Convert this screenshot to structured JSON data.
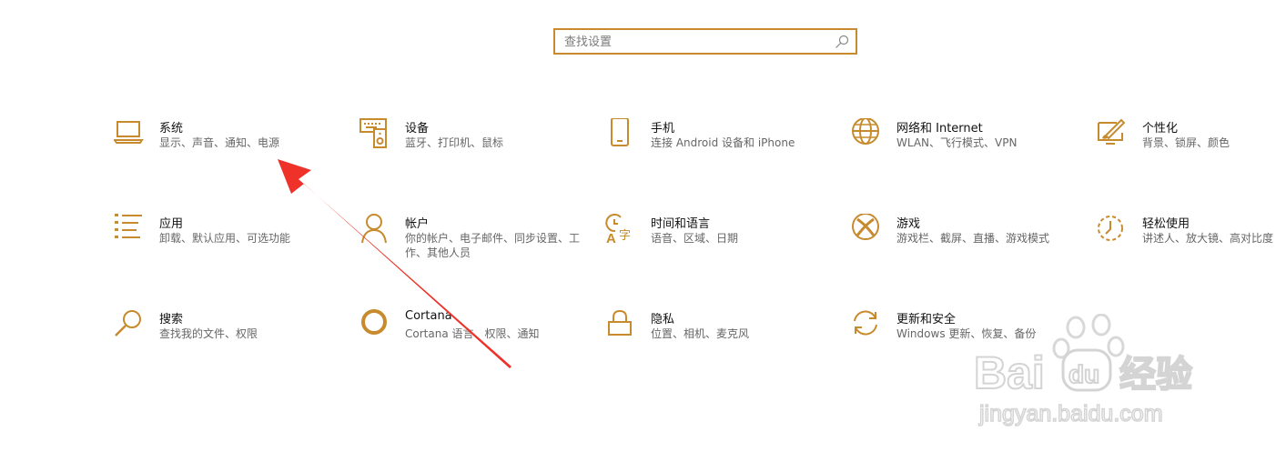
{
  "search": {
    "placeholder": "查找设置"
  },
  "accent": "#c78b2e",
  "tiles": [
    {
      "title": "系统",
      "desc": "显示、声音、通知、电源",
      "icon": "laptop-icon"
    },
    {
      "title": "设备",
      "desc": "蓝牙、打印机、鼠标",
      "icon": "keyboard-speaker-icon"
    },
    {
      "title": "手机",
      "desc": "连接 Android 设备和 iPhone",
      "icon": "phone-icon"
    },
    {
      "title": "网络和 Internet",
      "desc": "WLAN、飞行模式、VPN",
      "icon": "globe-icon"
    },
    {
      "title": "个性化",
      "desc": "背景、锁屏、颜色",
      "icon": "paint-icon"
    },
    {
      "title": "应用",
      "desc": "卸载、默认应用、可选功能",
      "icon": "list-icon"
    },
    {
      "title": "帐户",
      "desc": "你的帐户、电子邮件、同步设置、工作、其他人员",
      "icon": "person-icon"
    },
    {
      "title": "时间和语言",
      "desc": "语音、区域、日期",
      "icon": "time-language-icon"
    },
    {
      "title": "游戏",
      "desc": "游戏栏、截屏、直播、游戏模式",
      "icon": "xbox-icon"
    },
    {
      "title": "轻松使用",
      "desc": "讲述人、放大镜、高对比度",
      "icon": "ease-of-access-icon"
    },
    {
      "title": "搜索",
      "desc": "查找我的文件、权限",
      "icon": "search-icon"
    },
    {
      "title": "Cortana",
      "desc": "Cortana 语言、权限、通知",
      "icon": "cortana-icon"
    },
    {
      "title": "隐私",
      "desc": "位置、相机、麦克风",
      "icon": "lock-icon"
    },
    {
      "title": "更新和安全",
      "desc": "Windows 更新、恢复、备份",
      "icon": "refresh-icon"
    }
  ],
  "watermark": {
    "brand": "Bai",
    "brand2": "du",
    "cn": "经验",
    "url": "jingyan.baidu.com"
  }
}
